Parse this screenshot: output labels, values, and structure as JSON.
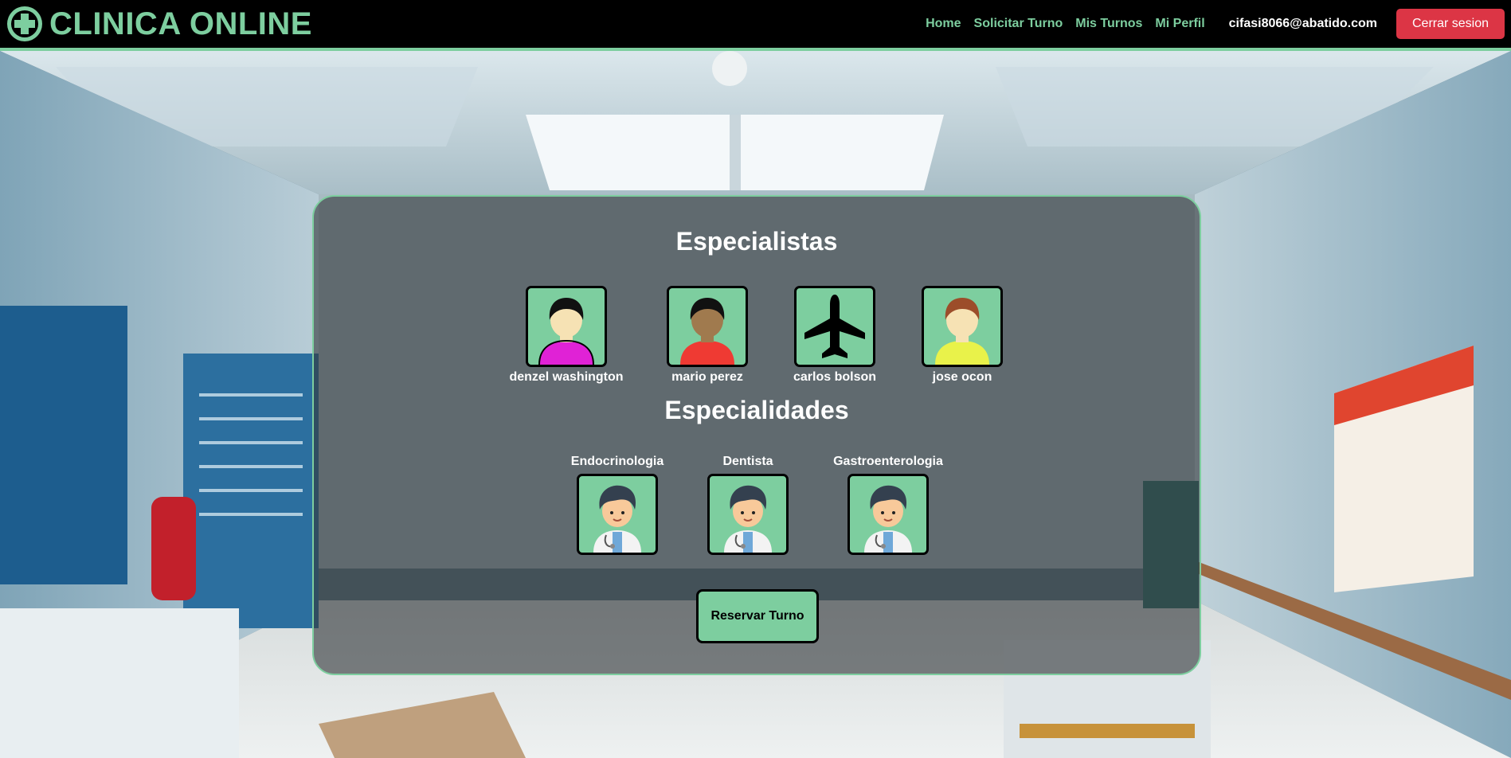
{
  "brand": {
    "title": "CLINICA ONLINE",
    "icon": "medical-cross-icon",
    "color": "#7dce9f"
  },
  "nav": {
    "links": [
      "Home",
      "Solicitar Turno",
      "Mis Turnos",
      "Mi Perfil"
    ],
    "user_email": "cifasi8066@abatido.com",
    "logout_label": "Cerrar sesion"
  },
  "main": {
    "specialists_title": "Especialistas",
    "specialists": [
      {
        "name": "denzel washington",
        "icon": "person-avatar-icon",
        "shirt_color": "#e022d6"
      },
      {
        "name": "mario perez",
        "icon": "person-avatar-icon",
        "shirt_color": "#ef3a33"
      },
      {
        "name": "carlos bolson",
        "icon": "airplane-icon"
      },
      {
        "name": "jose ocon",
        "icon": "person-avatar-icon",
        "shirt_color": "#e9f24a"
      }
    ],
    "specialties_title": "Especialidades",
    "specialties": [
      {
        "name": "Endocrinologia",
        "icon": "doctor-icon"
      },
      {
        "name": "Dentista",
        "icon": "doctor-icon"
      },
      {
        "name": "Gastroenterologia",
        "icon": "doctor-icon"
      }
    ],
    "reserve_label": "Reservar Turno"
  },
  "colors": {
    "accent": "#7dce9f",
    "danger": "#dc3545",
    "navbar": "#000000"
  }
}
